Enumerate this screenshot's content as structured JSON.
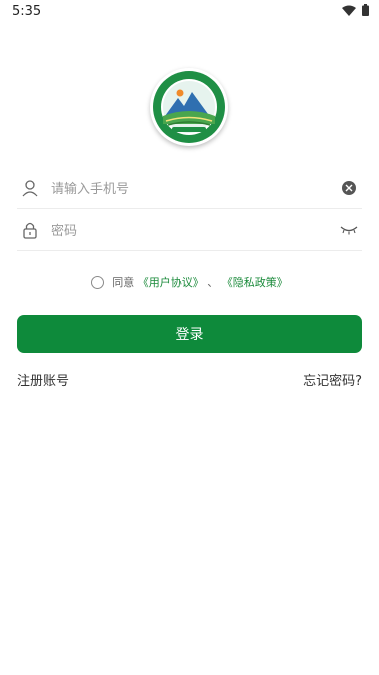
{
  "status_bar": {
    "time": "5:35",
    "wifi_icon": "wifi-icon",
    "battery_icon": "battery-icon"
  },
  "logo": {
    "icon": "app-logo-emblem"
  },
  "phone_field": {
    "placeholder": "请输入手机号",
    "value": "",
    "user_icon": "user-icon",
    "clear_icon": "clear-icon"
  },
  "password_field": {
    "placeholder": "密码",
    "value": "",
    "lock_icon": "lock-icon",
    "eye_icon": "eye-closed-icon"
  },
  "agreement": {
    "prefix": "同意",
    "user_agreement": "《用户协议》",
    "separator": "、",
    "privacy_policy": "《隐私政策》"
  },
  "login_button": {
    "label": "登录"
  },
  "links": {
    "register": "注册账号",
    "forgot_password": "忘记密码?"
  },
  "colors": {
    "primary": "#0e8a3b",
    "link": "#1a8a3a"
  }
}
